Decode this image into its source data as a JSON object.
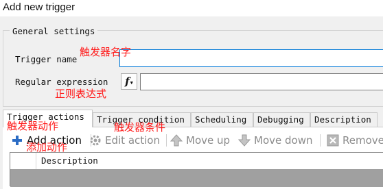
{
  "window": {
    "title": "Add new trigger"
  },
  "general": {
    "legend": "General settings",
    "trigger_name_label": "Trigger name",
    "trigger_name_value": "",
    "regex_label": "Regular expression",
    "regex_value": "",
    "function_button_label": "f"
  },
  "tabs": [
    {
      "label": "Trigger actions",
      "active": true
    },
    {
      "label": "Trigger condition",
      "active": false
    },
    {
      "label": "Scheduling",
      "active": false
    },
    {
      "label": "Debugging",
      "active": false
    },
    {
      "label": "Description",
      "active": false
    }
  ],
  "toolbar": {
    "add_action": "Add action",
    "edit_action": "Edit action",
    "move_up": "Move up",
    "move_down": "Move down",
    "remove": "Remove"
  },
  "grid": {
    "column_description": "Description"
  },
  "annotations": {
    "trigger_name": "触发器名字",
    "regex": "正则表达式",
    "trigger_actions": "触发器动作",
    "add_action": "添加动作",
    "trigger_condition": "触发器条件"
  },
  "colors": {
    "annotation": "#ff1a1a",
    "focus_border": "#0078d7",
    "add_icon": "#2b6cc4",
    "grid_body": "#a0a0a0"
  },
  "icons": {
    "add": "plus-icon",
    "edit": "gear-icon",
    "up": "arrow-up-icon",
    "down": "arrow-down-icon",
    "remove": "remove-icon",
    "function": "function-icon"
  }
}
